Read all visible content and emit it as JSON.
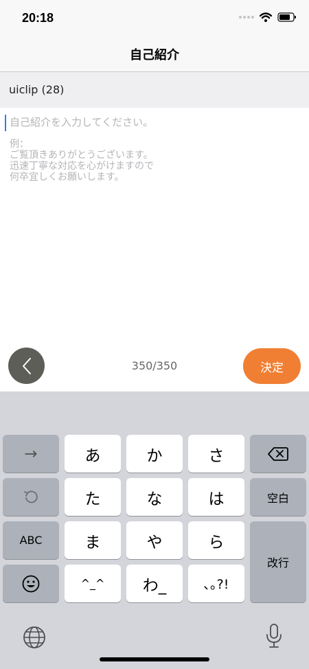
{
  "status_bar": {
    "time": "20:18"
  },
  "nav": {
    "title": "自己紹介"
  },
  "user": {
    "label": "uiclip (28)"
  },
  "editor": {
    "placeholder": "自己紹介を入力してください。",
    "example_lines": [
      "例：",
      "ご覧頂きありがとうございます。",
      "迅速丁寧な対応を心がけますので",
      "何卒宜しくお願いします。"
    ]
  },
  "bottom_bar": {
    "counter": "350/350",
    "confirm_label": "決定"
  },
  "keyboard": {
    "row1": [
      "→",
      "あ",
      "か",
      "さ"
    ],
    "row2": [
      "た",
      "な",
      "は",
      "空白"
    ],
    "row3": [
      "ABC",
      "ま",
      "や",
      "ら",
      "改行"
    ],
    "row4": [
      "^_^",
      "わ_",
      "､｡?!"
    ]
  },
  "colors": {
    "accent": "#f07f33",
    "caret": "#2f7cf6",
    "back_button": "#5e5e58"
  },
  "icons": [
    "signal-icon",
    "wifi-icon",
    "battery-icon",
    "back-chevron-icon",
    "undo-icon",
    "backspace-icon",
    "emoji-icon",
    "globe-icon",
    "microphone-icon"
  ]
}
